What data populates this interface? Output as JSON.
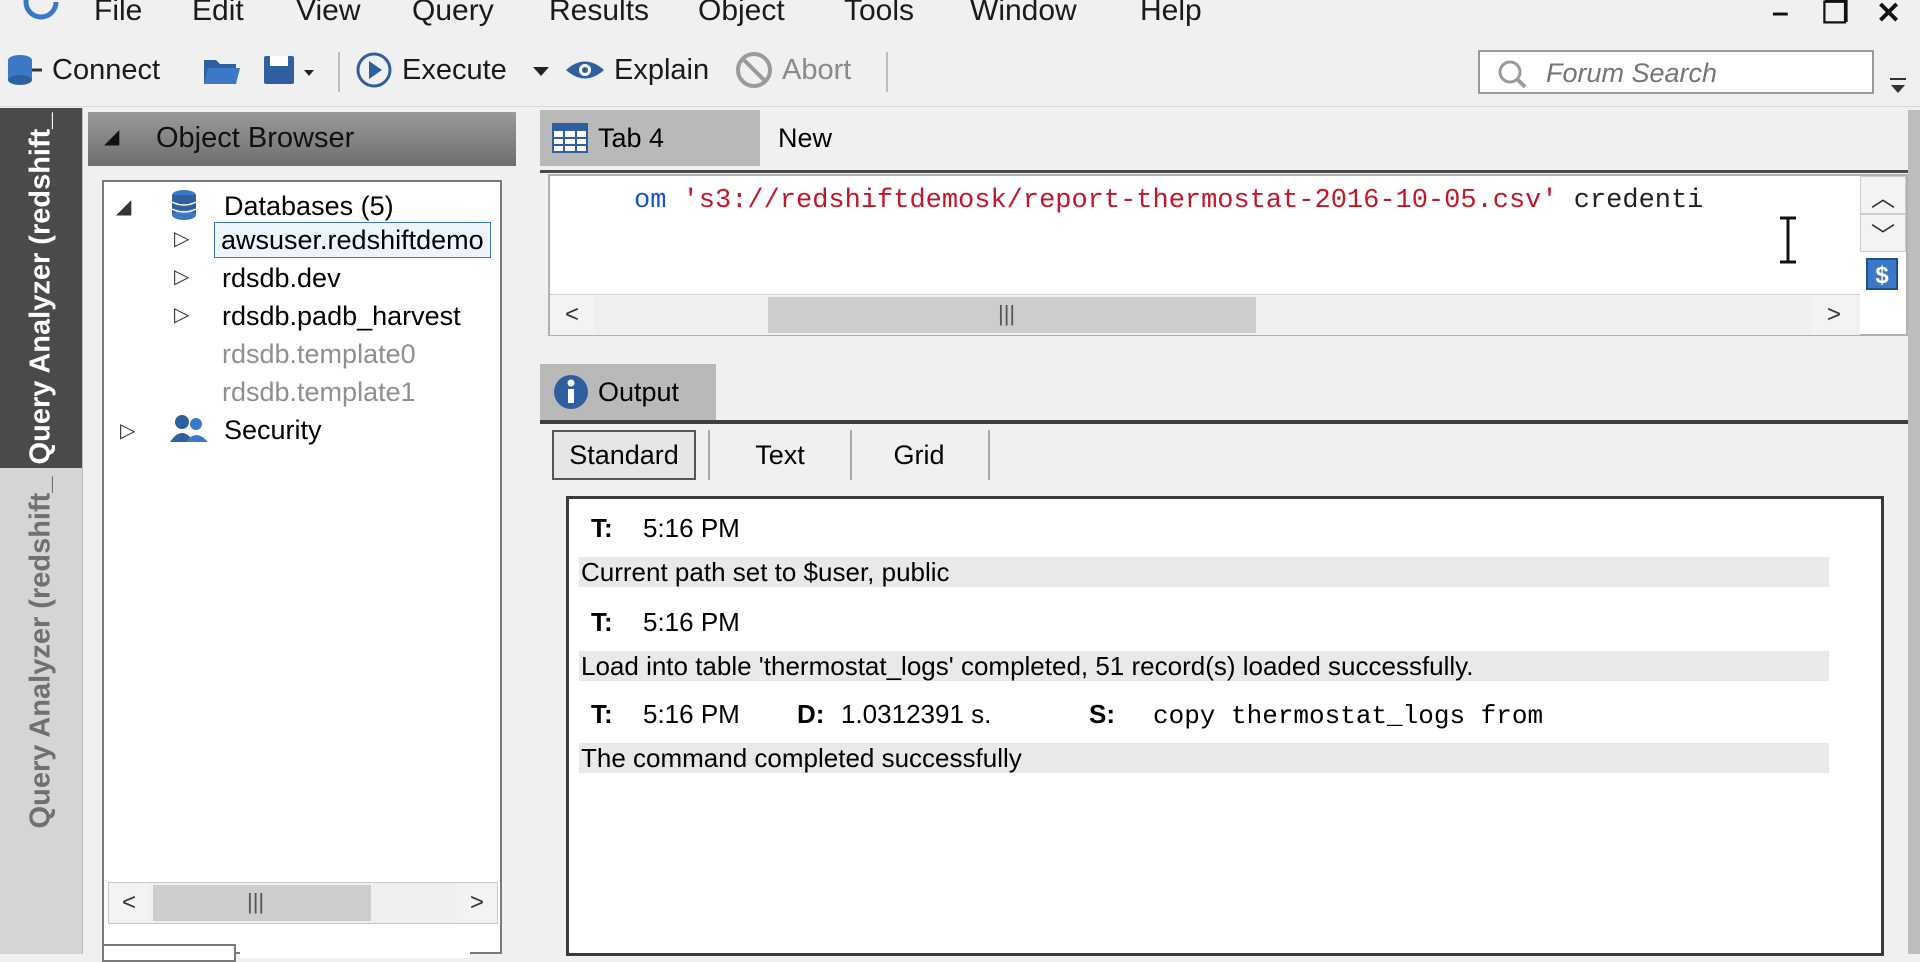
{
  "menu": [
    "File",
    "Edit",
    "View",
    "Query",
    "Results",
    "Object",
    "Tools",
    "Window",
    "Help"
  ],
  "window_controls": {
    "minimize": "–",
    "restore": "❐",
    "close": "✕"
  },
  "toolbar": {
    "connect": "Connect",
    "execute": "Execute",
    "explain": "Explain",
    "abort": "Abort",
    "search_placeholder": "Forum Search"
  },
  "side_tabs": [
    "Query Analyzer (redshift_",
    "Query Analyzer (redshift_"
  ],
  "object_browser": {
    "title": "Object Browser",
    "databases": "Databases (5)",
    "items": [
      {
        "label": "awsuser.redshiftdemo",
        "selected": true,
        "expandable": true
      },
      {
        "label": "rdsdb.dev",
        "expandable": true
      },
      {
        "label": "rdsdb.padb_harvest",
        "expandable": true
      },
      {
        "label": "rdsdb.template0",
        "disabled": true
      },
      {
        "label": "rdsdb.template1",
        "disabled": true
      }
    ],
    "security": "Security"
  },
  "editor": {
    "tabs": [
      "Tab 4",
      "New"
    ],
    "code_prefix": "om ",
    "code_string": "'s3://redshiftdemosk/report-thermostat-2016-10-05.csv'",
    "code_suffix": " credenti"
  },
  "output": {
    "tab": "Output",
    "subtabs": [
      "Standard",
      "Text",
      "Grid"
    ],
    "entries": [
      {
        "t_label": "T:",
        "time": "5:16 PM",
        "message": "Current path set to $user, public"
      },
      {
        "t_label": "T:",
        "time": "5:16 PM",
        "message": "Load into table 'thermostat_logs' completed, 51 record(s) loaded successfully."
      },
      {
        "t_label": "T:",
        "time": "5:16 PM",
        "d_label": "D:",
        "duration": "1.0312391 s.",
        "s_label": "S:",
        "statement": "copy thermostat_logs from",
        "message": "The command completed successfully"
      }
    ]
  },
  "colors": {
    "keyword": "#1a4fd6",
    "string": "#c2162a",
    "accent": "#3c78c8"
  }
}
